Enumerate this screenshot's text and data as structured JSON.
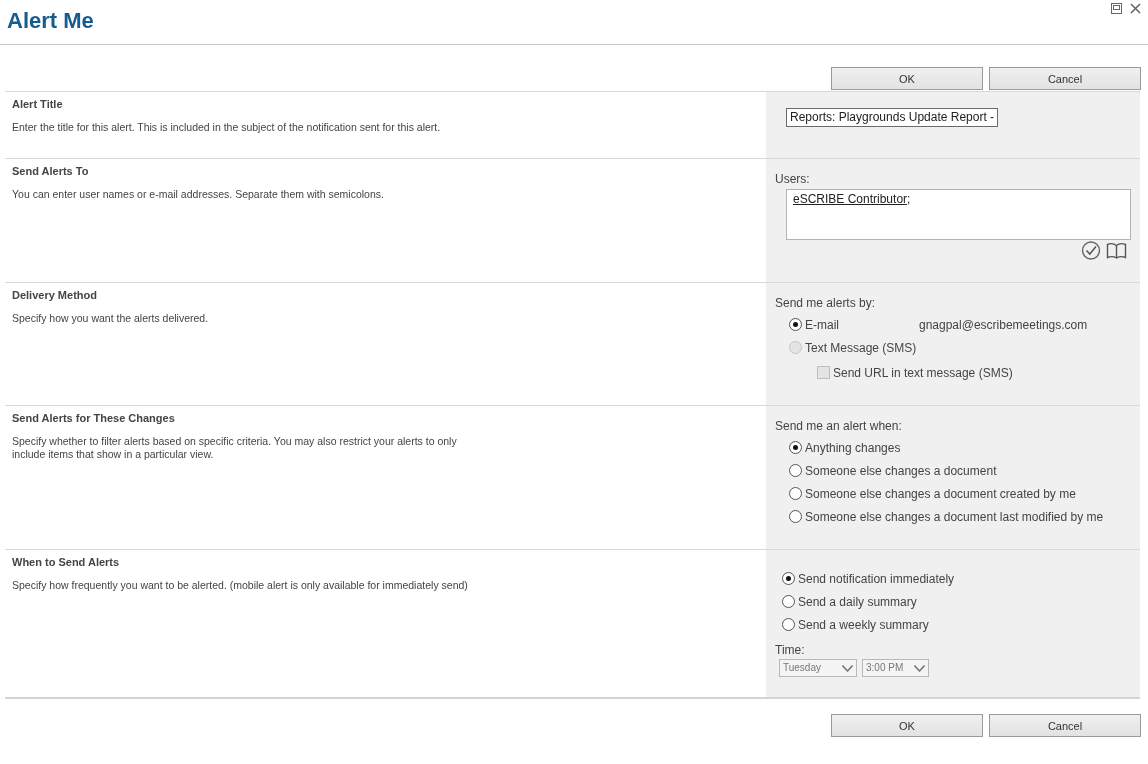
{
  "dialog": {
    "title": "Alert Me"
  },
  "top_buttons": [
    {
      "label": "OK"
    },
    {
      "label": "Cancel"
    }
  ],
  "sections": [
    {
      "kind": "text",
      "title": "Alert Title",
      "description": "Enter the title for this alert. This is included in the subject of the notification sent for this alert.",
      "field": {
        "value": "Reports: Playgrounds Update Report -"
      }
    },
    {
      "kind": "people",
      "title": "Send Alerts To",
      "description": "You can enter user names or e-mail addresses. Separate them with semicolons.",
      "field_label": "Users:",
      "entries": [
        {
          "name": "eSCRIBE Contributor",
          "separator": ";"
        }
      ]
    },
    {
      "kind": "choice",
      "title": "Delivery Method",
      "description": "Specify how you want the alerts delivered.",
      "prompt": "Send me alerts by:",
      "options": [
        {
          "label": "E-mail",
          "selected": true,
          "disabled": false,
          "detail": "gnagpal@escribemeetings.com"
        },
        {
          "label": "Text Message (SMS)",
          "selected": false,
          "disabled": true,
          "children": [
            {
              "label": "Send URL in text message (SMS)",
              "checked": false,
              "disabled": true
            }
          ]
        }
      ]
    },
    {
      "kind": "choice",
      "title": "Send Alerts for These Changes",
      "description": "Specify whether to filter alerts based on specific criteria. You may also restrict your alerts to only include items that show in a particular view.",
      "prompt": "Send me an alert when:",
      "options": [
        {
          "label": "Anything changes",
          "selected": true
        },
        {
          "label": "Someone else changes a document",
          "selected": false
        },
        {
          "label": "Someone else changes a document created by me",
          "selected": false
        },
        {
          "label": "Someone else changes a document last modified by me",
          "selected": false
        }
      ]
    },
    {
      "kind": "choice",
      "title": "When to Send Alerts",
      "description": "Specify how frequently you want to be alerted. (mobile alert is only available for immediately send)",
      "options": [
        {
          "label": "Send notification immediately",
          "selected": true
        },
        {
          "label": "Send a daily summary",
          "selected": false
        },
        {
          "label": "Send a weekly summary",
          "selected": false
        }
      ],
      "time": {
        "label": "Time:",
        "selects": [
          {
            "value": "Tuesday",
            "disabled": true
          },
          {
            "value": "3:00 PM",
            "disabled": true
          }
        ]
      }
    }
  ],
  "bottom_buttons": [
    {
      "label": "OK"
    },
    {
      "label": "Cancel"
    }
  ]
}
